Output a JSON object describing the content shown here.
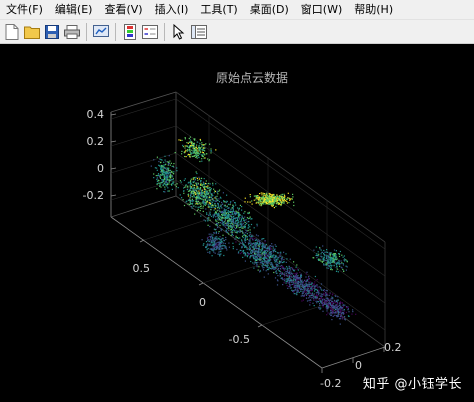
{
  "menubar": {
    "items": [
      "文件(F)",
      "编辑(E)",
      "查看(V)",
      "插入(I)",
      "工具(T)",
      "桌面(D)",
      "窗口(W)",
      "帮助(H)"
    ]
  },
  "toolbar": {
    "buttons": [
      "new-file-icon",
      "open-folder-icon",
      "save-icon",
      "print-icon",
      "link-plot-icon",
      "insert-colorbar-icon",
      "insert-legend-icon",
      "pointer-icon",
      "property-inspector-icon"
    ]
  },
  "figure": {
    "title": "原始点云数据",
    "z_ticks": [
      "0.4",
      "0.2",
      "0",
      "-0.2"
    ],
    "y_ticks": [
      "0.5",
      "0",
      "-0.5"
    ],
    "x_ticks": [
      "-0.2",
      "0",
      "0.2"
    ],
    "colors": {
      "background": "#000000",
      "axis": "#9a9a9a",
      "colormap": [
        "#440154",
        "#3b528b",
        "#21918c",
        "#5ec962",
        "#fde725"
      ]
    }
  },
  "watermark": "知乎 @小钰学长"
}
